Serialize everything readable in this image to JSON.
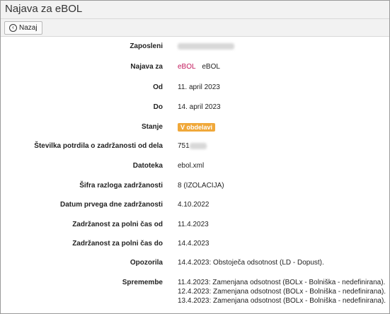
{
  "window": {
    "title": "Najava za eBOL"
  },
  "toolbar": {
    "back_label": "Nazaj"
  },
  "fields": {
    "zaposleni_label": "Zaposleni",
    "najava_label": "Najava za",
    "najava_link": "eBOL",
    "najava_value": "eBOL",
    "od_label": "Od",
    "od_value": "11. april 2023",
    "do_label": "Do",
    "do_value": "14. april 2023",
    "stanje_label": "Stanje",
    "stanje_value": "V obdelavi",
    "stevilka_label": "Številka potrdila o zadržanosti od dela",
    "stevilka_value": "751",
    "datoteka_label": "Datoteka",
    "datoteka_value": "ebol.xml",
    "sifra_label": "Šifra razloga zadržanosti",
    "sifra_value": "8 (IZOLACIJA)",
    "datum_label": "Datum prvega dne zadržanosti",
    "datum_value": "4.10.2022",
    "polni_od_label": "Zadržanost za polni čas od",
    "polni_od_value": "11.4.2023",
    "polni_do_label": "Zadržanost za polni čas do",
    "polni_do_value": "14.4.2023",
    "opozorila_label": "Opozorila",
    "opozorila_value": "14.4.2023:  Obstoječa odsotnost (LD - Dopust).",
    "spremembe_label": "Spremembe",
    "spremembe": [
      "11.4.2023:  Zamenjana odsotnost (BOLx - Bolniška - nedefinirana).",
      "12.4.2023:  Zamenjana odsotnost (BOLx - Bolniška - nedefinirana).",
      "13.4.2023:  Zamenjana odsotnost (BOLx - Bolniška - nedefinirana)."
    ]
  },
  "colors": {
    "badge": "#f0a83a",
    "link": "#c2185b"
  }
}
